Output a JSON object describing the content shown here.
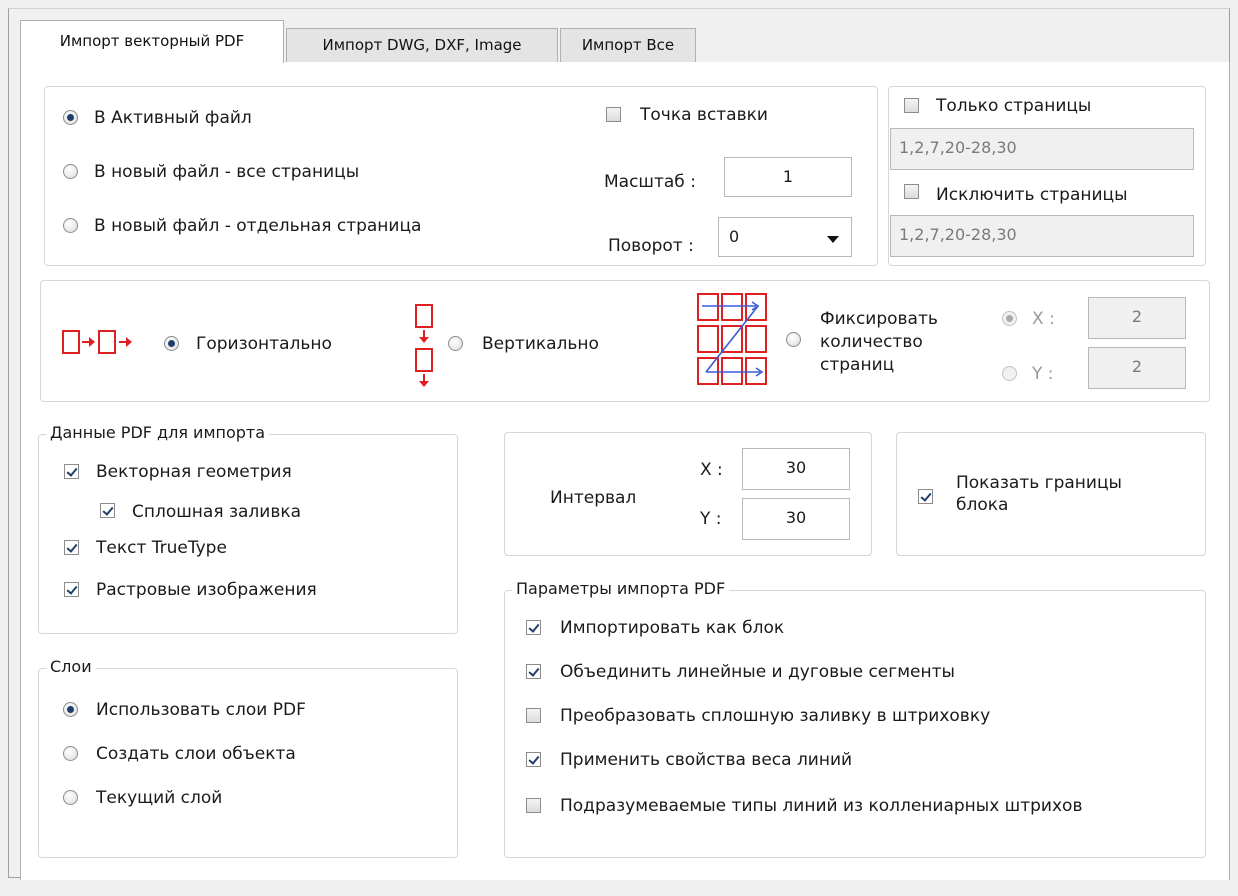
{
  "tabs": [
    "Импорт векторный PDF",
    "Импорт DWG, DXF, Image",
    "Импорт Все"
  ],
  "destination": {
    "options": [
      "В Активный файл",
      "В новый файл - все страницы",
      "В новый файл - отдельная страница"
    ],
    "selected_index": 0
  },
  "insertion": {
    "insert_point_label": "Точка вставки",
    "insert_point_checked": false,
    "scale_label": "Масштаб :",
    "scale_value": "1",
    "rotation_label": "Поворот :",
    "rotation_value": "0"
  },
  "pages": {
    "only_label": "Только страницы",
    "only_checked": false,
    "only_placeholder": "1,2,7,20-28,30",
    "exclude_label": "Исключить страницы",
    "exclude_checked": false,
    "exclude_placeholder": "1,2,7,20-28,30"
  },
  "arrangement": {
    "horizontal_label": "Горизонтально",
    "vertical_label": "Вертикально",
    "fixed_label_1": "Фиксировать",
    "fixed_label_2": "количество",
    "fixed_label_3": "страниц",
    "selected": "horizontal",
    "x_label": "X :",
    "x_value": "2",
    "y_label": "Y :",
    "y_value": "2"
  },
  "pdf_data": {
    "legend": "Данные PDF для импорта",
    "vector_geometry": "Векторная геометрия",
    "solid_fill": "Сплошная заливка",
    "text_truetype": "Текст TrueType",
    "raster_images": "Растровые изображения",
    "checked": [
      true,
      true,
      true,
      true
    ]
  },
  "interval": {
    "label": "Интервал",
    "x_label": "X :",
    "x_value": "30",
    "y_label": "Y :",
    "y_value": "30"
  },
  "block_bounds": {
    "label_1": "Показать границы",
    "label_2": "блока",
    "checked": true
  },
  "layers": {
    "legend": "Слои",
    "options": [
      "Использовать слои PDF",
      "Создать слои объекта",
      "Текущий слой"
    ],
    "selected_index": 0
  },
  "import_params": {
    "legend": "Параметры импорта PDF",
    "items": [
      {
        "label": "Импортировать как блок",
        "checked": true
      },
      {
        "label": "Объединить линейные и дуговые сегменты",
        "checked": true
      },
      {
        "label": "Преобразовать сплошную заливку в штриховку",
        "checked": false
      },
      {
        "label": "Применить свойства веса линий",
        "checked": true
      },
      {
        "label": "Подразумеваемые типы линий из коллениарных штрихов",
        "checked": false
      }
    ]
  },
  "colors": {
    "accent_red": "#e02020",
    "accent_blue": "#3b5bd6"
  }
}
